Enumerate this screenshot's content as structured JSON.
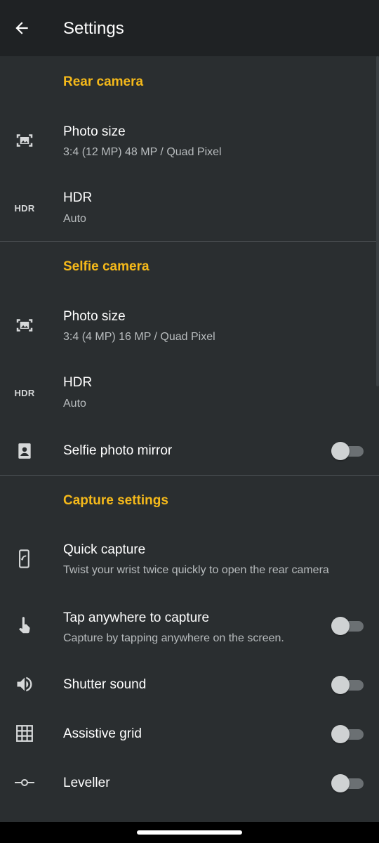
{
  "header": {
    "title": "Settings"
  },
  "sections": {
    "rear": {
      "title": "Rear camera",
      "photo_size": {
        "title": "Photo size",
        "value": "3:4 (12 MP) 48 MP / Quad Pixel"
      },
      "hdr": {
        "icon_label": "HDR",
        "title": "HDR",
        "value": "Auto"
      }
    },
    "selfie": {
      "title": "Selfie camera",
      "photo_size": {
        "title": "Photo size",
        "value": "3:4 (4 MP) 16 MP / Quad Pixel"
      },
      "hdr": {
        "icon_label": "HDR",
        "title": "HDR",
        "value": "Auto"
      },
      "mirror": {
        "title": "Selfie photo mirror",
        "enabled": false
      }
    },
    "capture": {
      "title": "Capture settings",
      "quick_capture": {
        "title": "Quick capture",
        "subtitle": "Twist your wrist twice quickly to open the rear camera"
      },
      "tap_capture": {
        "title": "Tap anywhere to capture",
        "subtitle": "Capture by tapping anywhere on the screen.",
        "enabled": false
      },
      "shutter_sound": {
        "title": "Shutter sound",
        "enabled": false
      },
      "assistive_grid": {
        "title": "Assistive grid",
        "enabled": false
      },
      "leveller": {
        "title": "Leveller",
        "enabled": false
      }
    }
  },
  "colors": {
    "accent": "#f5b91a",
    "background": "#2a2e30",
    "appbar": "#1f2224",
    "text_primary": "#ffffff",
    "text_secondary": "#b8bcbe",
    "toggle_off_track": "#6b7073",
    "toggle_off_thumb": "#cfd2d3"
  },
  "icons": {
    "back": "arrow-left-icon",
    "photo_size": "photo-size-icon",
    "hdr": "hdr-icon",
    "selfie_mirror": "selfie-portrait-icon",
    "quick_capture": "phone-twist-icon",
    "tap_capture": "touch-icon",
    "shutter_sound": "volume-icon",
    "assistive_grid": "grid-icon",
    "leveller": "leveller-icon"
  }
}
